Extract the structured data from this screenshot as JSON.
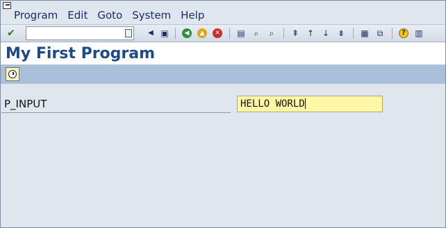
{
  "menu": {
    "items": [
      "Program",
      "Edit",
      "Goto",
      "System",
      "Help"
    ]
  },
  "toolbar": {
    "icons": [
      "enter-check-icon",
      "command-field",
      "command-dropdown-icon",
      "back-arrow-icon",
      "save-icon",
      "back-icon",
      "exit-icon",
      "cancel-icon",
      "print-icon",
      "find-icon",
      "find-next-icon",
      "first-page-icon",
      "previous-page-icon",
      "next-page-icon",
      "last-page-icon",
      "create-session-icon",
      "shortcut-icon",
      "help-icon",
      "layout-menu-icon"
    ]
  },
  "title": {
    "text": "My First Program"
  },
  "app_toolbar": {
    "execute_icon": "execute-clock-icon"
  },
  "form": {
    "label": "P_INPUT",
    "value": "HELLO WORLD"
  },
  "colors": {
    "title": "#1e4a8a",
    "app_toolbar": "#a9bfda",
    "input_bg": "#fff6a6",
    "background": "#dfe6ee"
  }
}
